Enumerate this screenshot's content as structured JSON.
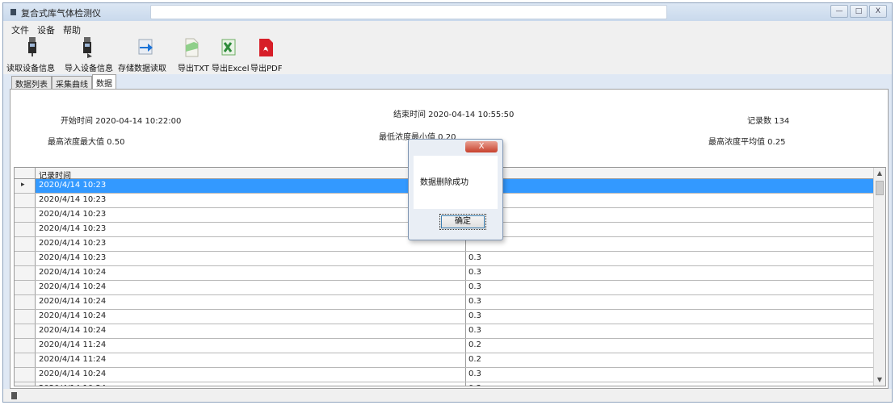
{
  "window": {
    "title": "复合式库气体检测仪",
    "controls": [
      "—",
      "□",
      "X"
    ]
  },
  "menu": [
    "文件",
    "设备",
    "帮助"
  ],
  "toolbar": [
    {
      "label": "读取设备信息",
      "icon": "device-read-icon"
    },
    {
      "label": "导入设备信息",
      "icon": "device-import-icon"
    },
    {
      "label": "存储数据读取",
      "icon": "data-read-arrow-icon"
    },
    {
      "label": "导出TXT",
      "icon": "export-txt-icon"
    },
    {
      "label": "导出Excel",
      "icon": "export-excel-icon"
    },
    {
      "label": "导出PDF",
      "icon": "export-pdf-icon"
    }
  ],
  "tabs": [
    {
      "label": "数据列表",
      "active": false
    },
    {
      "label": "采集曲线",
      "active": false
    },
    {
      "label": "数据",
      "active": true
    }
  ],
  "info": {
    "start_time": "开始时间  2020-04-14 10:22:00",
    "end_time": "结束时间  2020-04-14 10:55:50",
    "record_count": "记录数  134",
    "max_value": "最高浓度最大值  0.50",
    "min_value": "最低浓度最小值  0.20",
    "avg_value": "最高浓度平均值  0.25"
  },
  "table": {
    "columns": [
      "记录时间",
      ""
    ],
    "rows": [
      {
        "time": "2020/4/14 10:23",
        "value": ""
      },
      {
        "time": "2020/4/14 10:23",
        "value": ""
      },
      {
        "time": "2020/4/14 10:23",
        "value": ""
      },
      {
        "time": "2020/4/14 10:23",
        "value": ""
      },
      {
        "time": "2020/4/14 10:23",
        "value": ""
      },
      {
        "time": "2020/4/14 10:23",
        "value": "0.3"
      },
      {
        "time": "2020/4/14 10:24",
        "value": "0.3"
      },
      {
        "time": "2020/4/14 10:24",
        "value": "0.3"
      },
      {
        "time": "2020/4/14 10:24",
        "value": "0.3"
      },
      {
        "time": "2020/4/14 10:24",
        "value": "0.3"
      },
      {
        "time": "2020/4/14 10:24",
        "value": "0.3"
      },
      {
        "time": "2020/4/14 11:24",
        "value": "0.2"
      },
      {
        "time": "2020/4/14 11:24",
        "value": "0.2"
      },
      {
        "time": "2020/4/14 10:24",
        "value": "0.3"
      },
      {
        "time": "2020/4/14 10:24",
        "value": "0.3"
      }
    ]
  },
  "dialog": {
    "close_label": "X",
    "message": "数据删除成功",
    "ok_label": "确定"
  },
  "colors": {
    "selection": "#3399ff",
    "pdf_red": "#d71e28",
    "excel_green": "#2e8b3a"
  }
}
